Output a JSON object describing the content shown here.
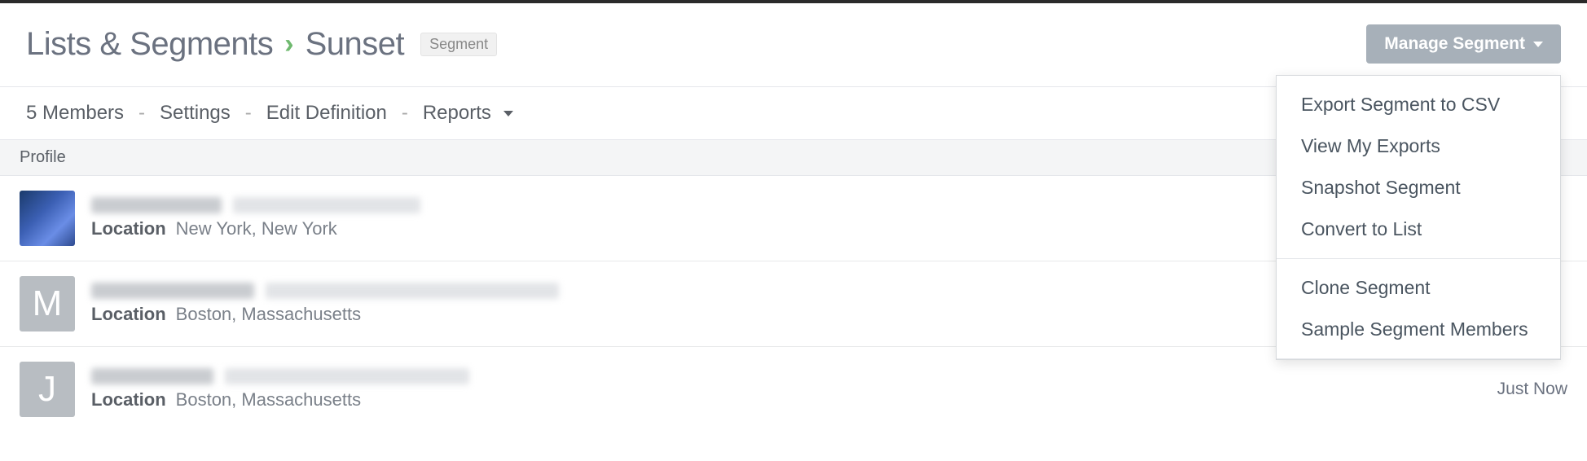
{
  "breadcrumb": {
    "root": "Lists & Segments",
    "leaf": "Sunset",
    "badge": "Segment"
  },
  "manage_button": "Manage Segment",
  "tabs": {
    "members": "5 Members",
    "settings": "Settings",
    "edit_def": "Edit Definition",
    "reports": "Reports"
  },
  "column_header": "Profile",
  "rows": [
    {
      "avatar_type": "image",
      "avatar_letter": "",
      "location_label": "Location",
      "location_value": "New York, New York",
      "right_text": ""
    },
    {
      "avatar_type": "letter",
      "avatar_letter": "M",
      "location_label": "Location",
      "location_value": "Boston, Massachusetts",
      "right_text": ""
    },
    {
      "avatar_type": "letter",
      "avatar_letter": "J",
      "location_label": "Location",
      "location_value": "Boston, Massachusetts",
      "right_text": "Just Now"
    }
  ],
  "dropdown": {
    "group1": [
      "Export Segment to CSV",
      "View My Exports",
      "Snapshot Segment",
      "Convert to List"
    ],
    "group2": [
      "Clone Segment",
      "Sample Segment Members"
    ]
  }
}
